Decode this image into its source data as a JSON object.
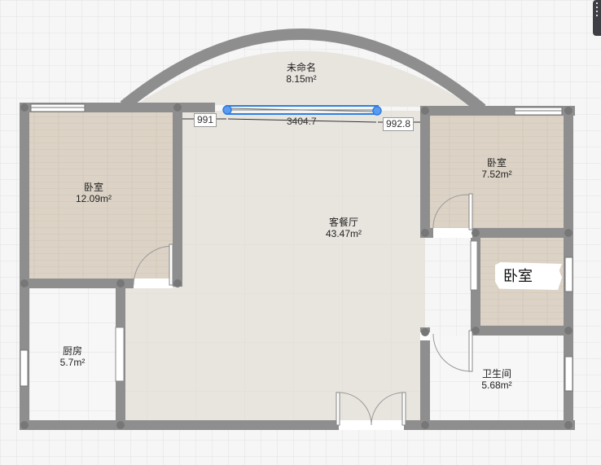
{
  "rooms": {
    "unnamed": {
      "name": "未命名",
      "area": "8.15m²"
    },
    "bedroom_left": {
      "name": "卧室",
      "area": "12.09m²"
    },
    "living": {
      "name": "客餐厅",
      "area": "43.47m²"
    },
    "bedroom_right": {
      "name": "卧室",
      "area": "7.52m²"
    },
    "bedroom_small": {
      "name": "卧室"
    },
    "kitchen": {
      "name": "厨房",
      "area": "5.7m²"
    },
    "bathroom": {
      "name": "卫生间",
      "area": "5.68m²"
    }
  },
  "dimensions": {
    "left": "991",
    "middle": "3404.7",
    "right": "992.8"
  },
  "colors": {
    "wall": "#8e8e8e",
    "wood_floor": "#dcd3c6",
    "tile_floor": "#e8e5df",
    "selection": "#2f7fe0"
  }
}
